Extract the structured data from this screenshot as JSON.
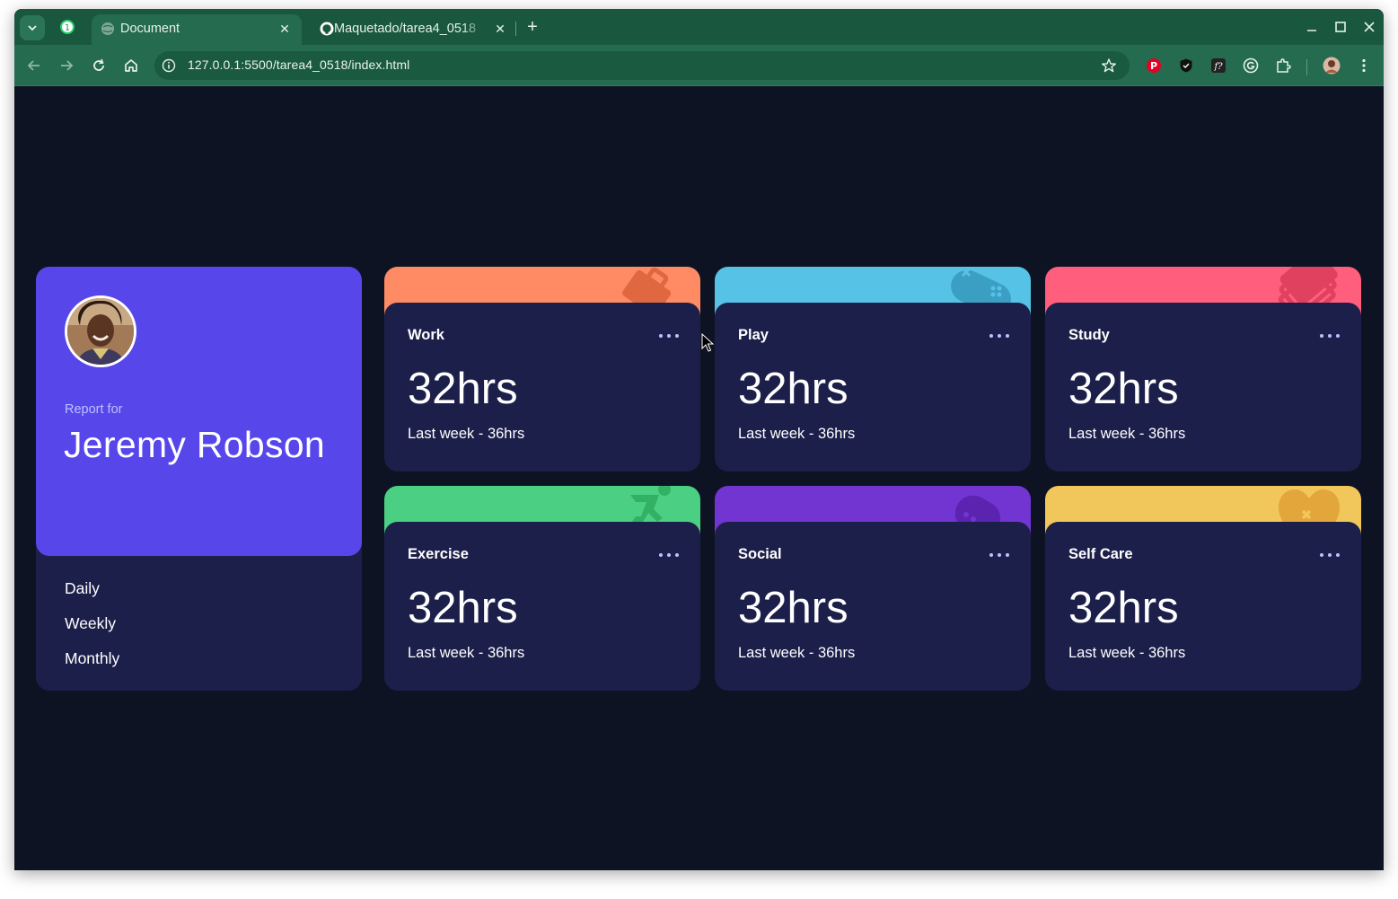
{
  "browser": {
    "tabs": [
      {
        "title": "Document",
        "active": true
      },
      {
        "title": "Maquetado/tarea4_0518",
        "active": false
      }
    ],
    "notification_badge": "1",
    "url": "127.0.0.1:5500/tarea4_0518/index.html",
    "accent_color": "#256b50"
  },
  "profile": {
    "report_label": "Report for",
    "name": "Jeremy Robson",
    "periods": [
      "Daily",
      "Weekly",
      "Monthly"
    ],
    "color": "#5747ea"
  },
  "cards": [
    {
      "title": "Work",
      "hours": "32hrs",
      "previous": "Last week - 36hrs",
      "color": "#ff8b64",
      "icon": "work-icon"
    },
    {
      "title": "Play",
      "hours": "32hrs",
      "previous": "Last week - 36hrs",
      "color": "#55c2e6",
      "icon": "play-icon"
    },
    {
      "title": "Study",
      "hours": "32hrs",
      "previous": "Last week - 36hrs",
      "color": "#ff5e7d",
      "icon": "study-icon"
    },
    {
      "title": "Exercise",
      "hours": "32hrs",
      "previous": "Last week - 36hrs",
      "color": "#4bcf82",
      "icon": "exercise-icon"
    },
    {
      "title": "Social",
      "hours": "32hrs",
      "previous": "Last week - 36hrs",
      "color": "#7335d2",
      "icon": "social-icon"
    },
    {
      "title": "Self Care",
      "hours": "32hrs",
      "previous": "Last week - 36hrs",
      "color": "#f1c75b",
      "icon": "self-care-icon"
    }
  ]
}
